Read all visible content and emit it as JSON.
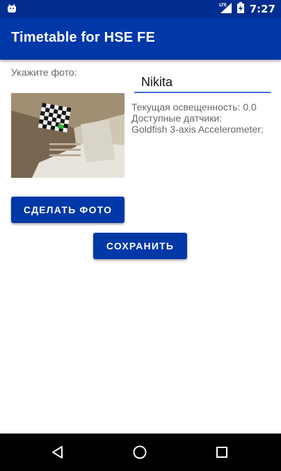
{
  "status_bar": {
    "network": "LTE",
    "time": "7:27"
  },
  "app_bar": {
    "title": "Timetable for HSE FE"
  },
  "form": {
    "photo_label": "Укажите фото:",
    "name_value": "Nikita",
    "illumination_text": "Текущая освещенность: 0.0",
    "sensors_label": "Доступные датчики:",
    "sensors_list": "Goldfish 3-axis Accelerometer;",
    "take_photo_label": "СДЕЛАТЬ ФОТО",
    "save_label": "СОХРАНИТЬ"
  },
  "colors": {
    "primary": "#0038a8",
    "primary_dark": "#002d8f",
    "accent": "#3d6fdc"
  },
  "icons": {
    "status": [
      "android-icon",
      "lte-signal-icon",
      "battery-charging-icon"
    ],
    "nav": [
      "back-icon",
      "home-icon",
      "recents-icon"
    ]
  }
}
